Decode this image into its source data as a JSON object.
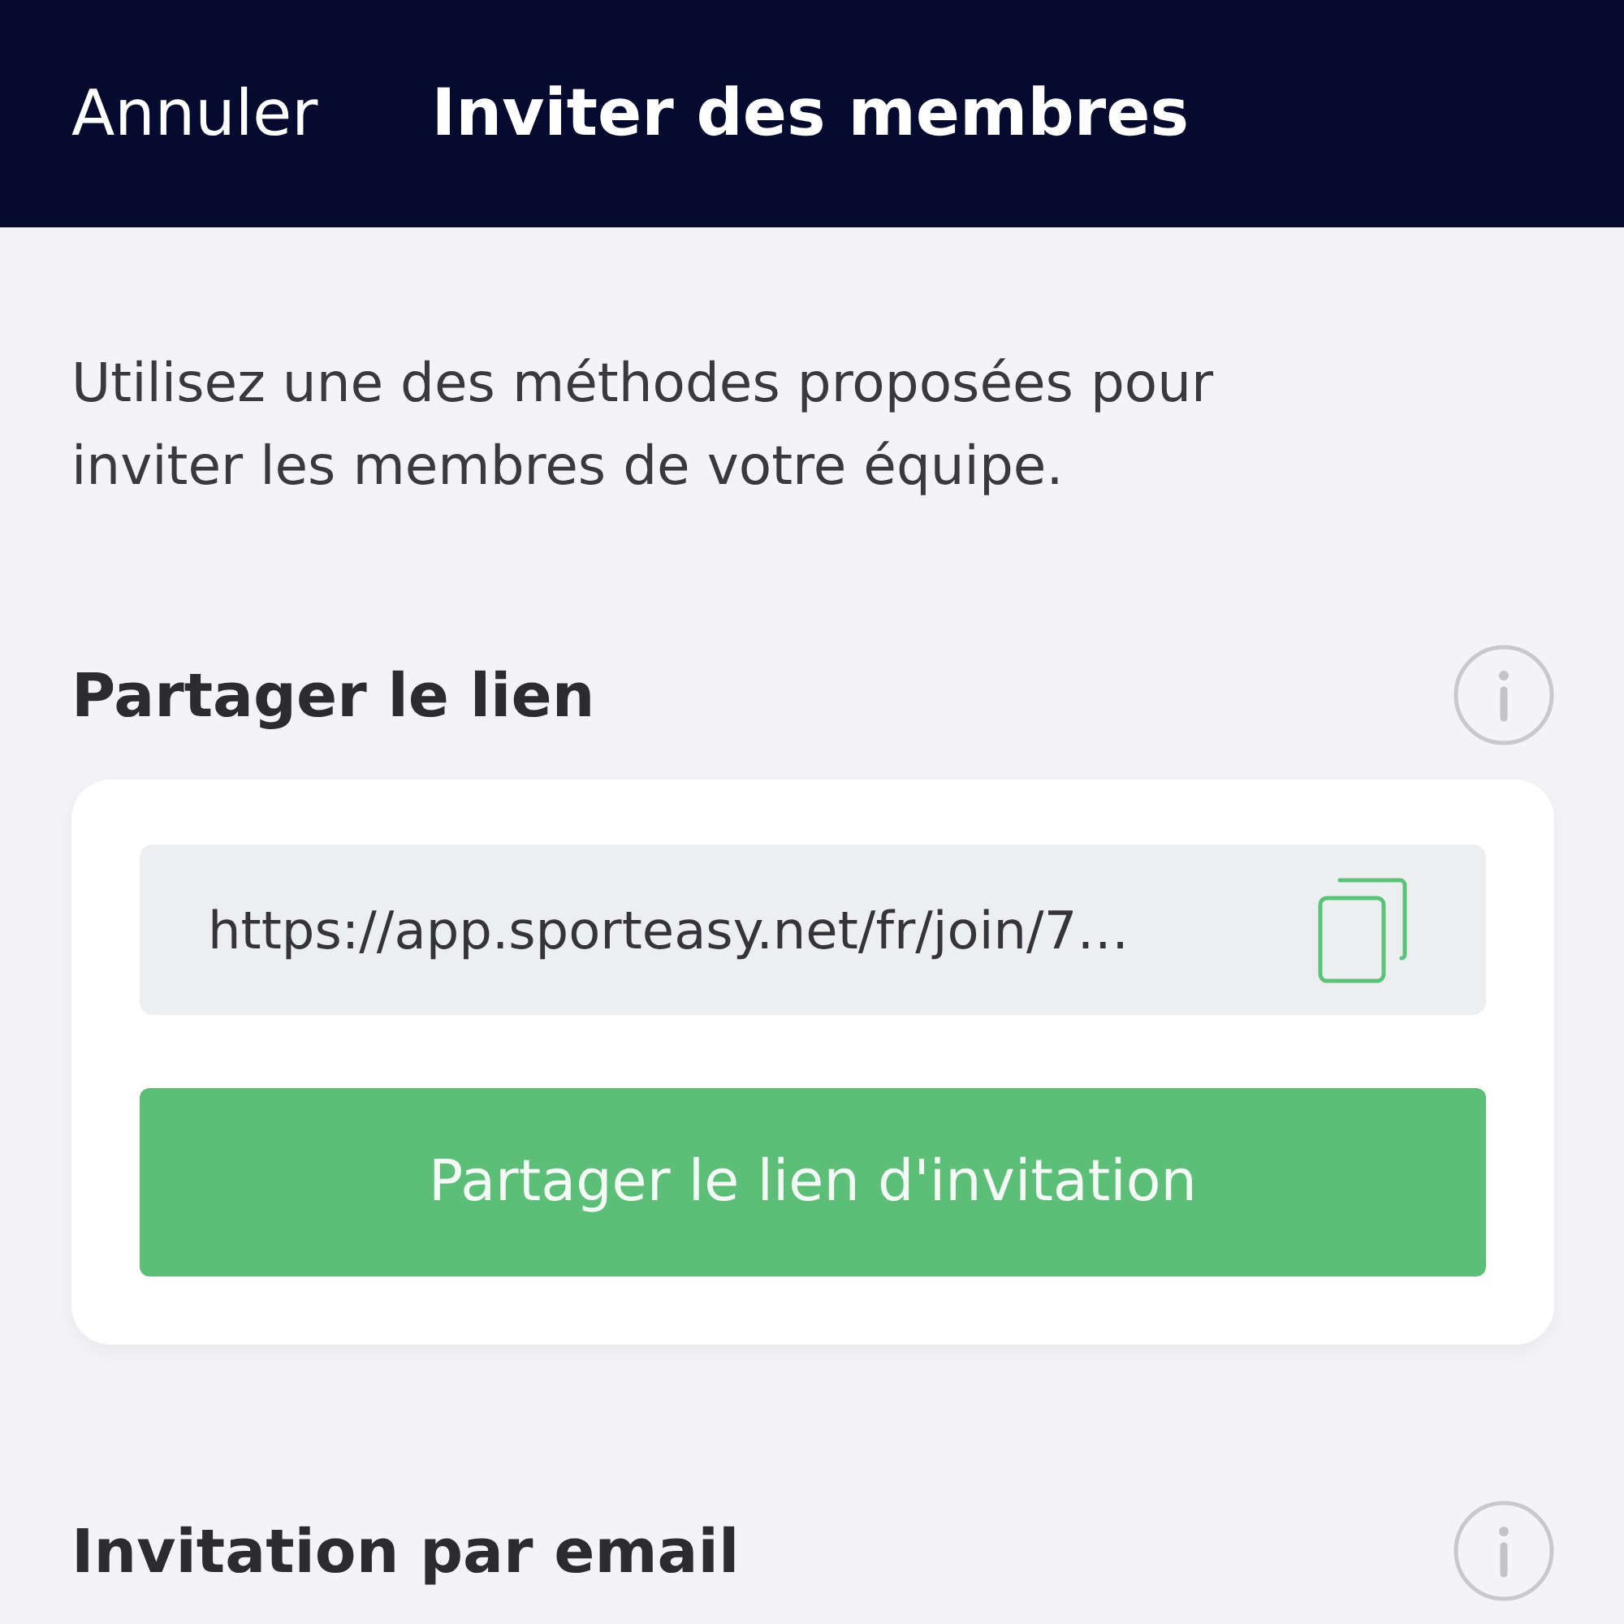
{
  "header": {
    "cancel": "Annuler",
    "title": "Inviter des membres"
  },
  "intro": "Utilisez une des méthodes proposées pour inviter les membres de votre équipe.",
  "sections": [
    {
      "title": "Partager le lien",
      "link_field": {
        "value": "https://app.sporteasy.net/fr/join/7…"
      },
      "share_button": "Partager le lien d'invitation"
    },
    {
      "title": "Invitation par email"
    }
  ]
}
